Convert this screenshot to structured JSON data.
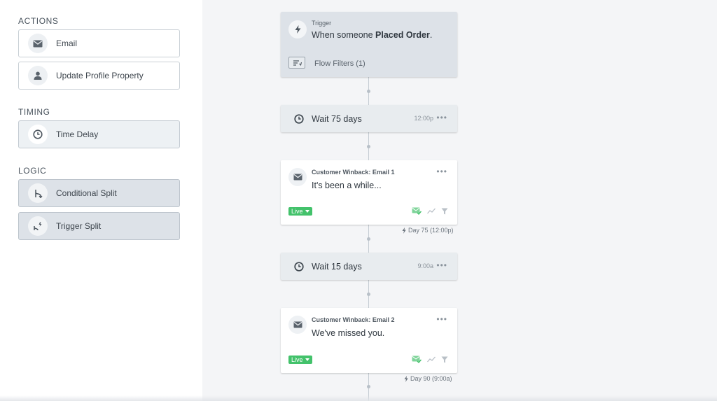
{
  "sidebar": {
    "actions_title": "ACTIONS",
    "timing_title": "TIMING",
    "logic_title": "LOGIC",
    "actions": [
      {
        "label": "Email",
        "icon": "envelope-icon"
      },
      {
        "label": "Update Profile Property",
        "icon": "person-icon"
      }
    ],
    "timing": [
      {
        "label": "Time Delay",
        "icon": "clock-icon"
      }
    ],
    "logic": [
      {
        "label": "Conditional Split",
        "icon": "split-icon"
      },
      {
        "label": "Trigger Split",
        "icon": "trigger-split-icon"
      }
    ]
  },
  "flow": {
    "trigger": {
      "label": "Trigger",
      "text_prefix": "When someone",
      "metric": "Placed Order",
      "text_suffix": ".",
      "filters": "Flow Filters (1)"
    },
    "wait1": {
      "label": "Wait 75 days",
      "time": "12:00p"
    },
    "email1": {
      "name": "Customer Winback: Email 1",
      "subject": "It's been a while...",
      "status": "Live",
      "day": "Day 75 (12:00p)"
    },
    "wait2": {
      "label": "Wait 15 days",
      "time": "9:00a"
    },
    "email2": {
      "name": "Customer Winback: Email 2",
      "subject": "We've missed you.",
      "status": "Live",
      "day": "Day 90 (9:00a)"
    },
    "more_dots": "•••"
  },
  "colors": {
    "live_green": "#43c26b",
    "canvas_bg": "#f4f5f7",
    "trigger_bg": "#dde2e8"
  }
}
